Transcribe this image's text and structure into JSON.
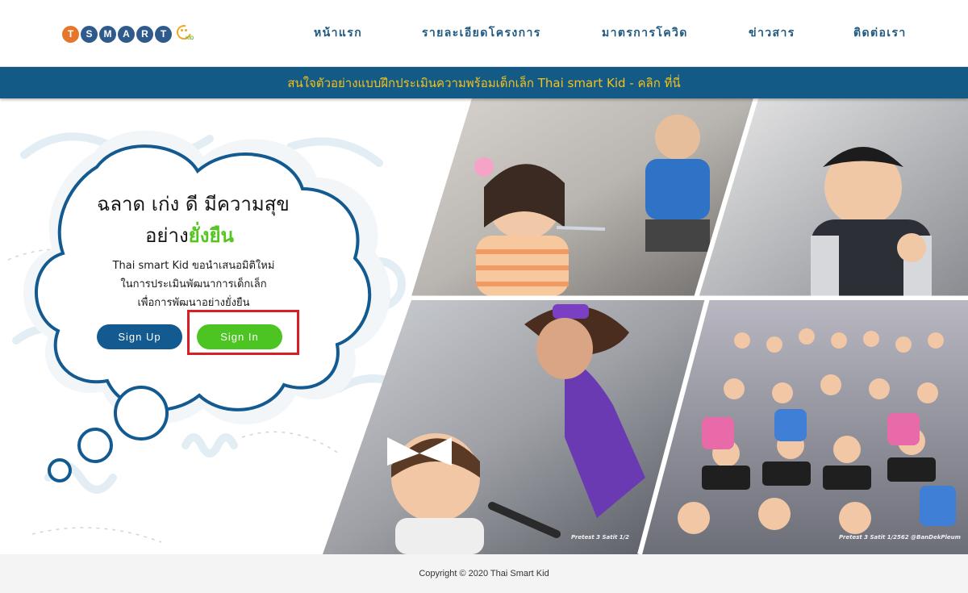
{
  "logo": {
    "letters": [
      "T",
      "S",
      "M",
      "A",
      "R",
      "T"
    ],
    "kid_text": "KID",
    "letter_colors": [
      "#e6762a",
      "#2e5a8c",
      "#2e5a8c",
      "#2e5a8c",
      "#2e5a8c",
      "#2e5a8c"
    ]
  },
  "nav": {
    "items": [
      {
        "label": "หน้าแรก"
      },
      {
        "label": "รายละเอียดโครงการ"
      },
      {
        "label": "มาตรการโควิด"
      },
      {
        "label": "ข่าวสาร"
      },
      {
        "label": "ติดต่อเรา"
      }
    ]
  },
  "banner": {
    "text": "สนใจตัวอย่างแบบฝึกประเมินความพร้อมเด็กเล็ก Thai smart Kid - คลิก ที่นี่"
  },
  "hero": {
    "headline_line1": "ฉลาด เก่ง ดี มีความสุข",
    "headline_line2_prefix": "อย่าง",
    "headline_line2_accent": "ยั่งยืน",
    "desc_line1": "Thai smart Kid ขอนำเสนอมิติใหม่",
    "desc_line2": "ในการประเมินพัฒนาการเด็กเล็ก",
    "desc_line3": "เพื่อการพัฒนาอย่างยั่งยืน",
    "signup_label": "Sign Up",
    "signin_label": "Sign In"
  },
  "photos": {
    "caption_left": "Pretest 3 Satit 1/2",
    "caption_right": "Pretest 3 Satit 1/2562 @BanDekPleum"
  },
  "colors": {
    "brand_blue": "#135a86",
    "banner_text": "#f4c21a",
    "accent_green": "#4cc421",
    "highlight_red": "#d91e25"
  },
  "footer": {
    "copyright": "Copyright © 2020 Thai Smart Kid"
  }
}
